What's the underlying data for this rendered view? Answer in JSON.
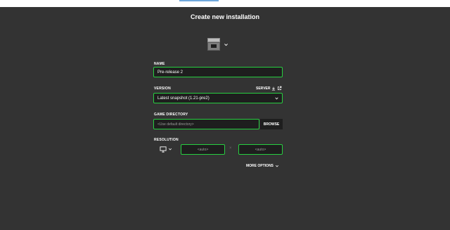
{
  "dialog": {
    "title": "Create new installation"
  },
  "icon_picker": {
    "icon": "furnace-block-icon"
  },
  "name": {
    "label": "NAME",
    "value": "Pre-release 2"
  },
  "version": {
    "label": "VERSION",
    "server_link": "SERVER",
    "value": "Latest snapshot (1.21-pre2)"
  },
  "game_directory": {
    "label": "GAME DIRECTORY",
    "placeholder": "<Use default directory>",
    "browse_label": "BROWSE"
  },
  "resolution": {
    "label": "RESOLUTION",
    "width_value": "<auto>",
    "separator": "×",
    "height_value": "<auto>"
  },
  "more_options": {
    "label": "MORE OPTIONS"
  },
  "colors": {
    "background": "#333333",
    "field_bg": "#1e1e1e",
    "accent_green": "#27ce40"
  }
}
